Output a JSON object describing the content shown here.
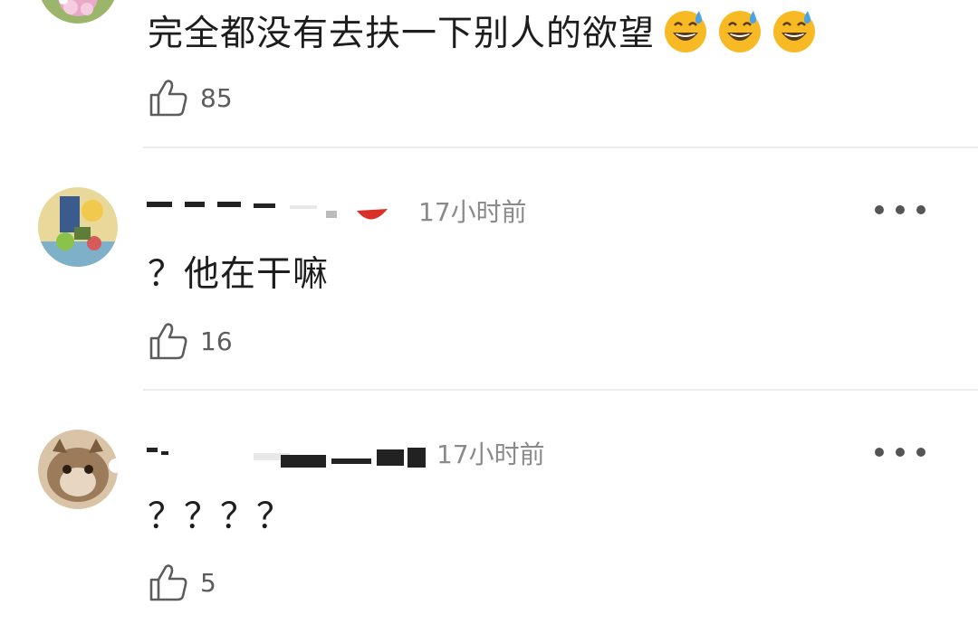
{
  "comments": [
    {
      "text": "完全都没有去扶一下别人的欲望",
      "emojis": [
        "sweat-smile-emoji",
        "sweat-smile-emoji",
        "sweat-smile-emoji"
      ],
      "likes": "85"
    },
    {
      "timestamp": "17小时前",
      "text": "？他在干嘛",
      "likes": "16"
    },
    {
      "timestamp": "17小时前",
      "text": "？？？？",
      "likes": "5"
    }
  ],
  "colors": {
    "timestamp": "#8a8a8a",
    "like_count": "#5c5c5c",
    "divider": "#ececec",
    "emoji_face": "#f7b924",
    "sweat_drop": "#4aa3e6"
  },
  "icons": {
    "like": "thumbs-up-outline-icon",
    "more": "ellipsis-horizontal-icon"
  }
}
